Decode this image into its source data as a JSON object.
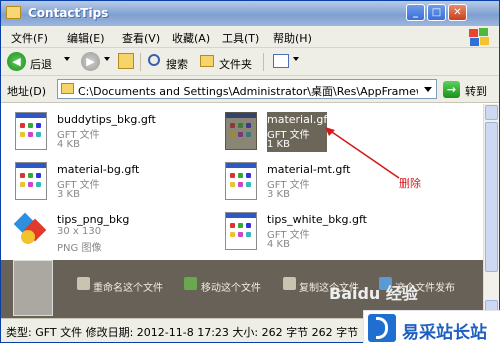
{
  "window": {
    "title": "ContactTips"
  },
  "menubar": {
    "items": [
      "文件(F)",
      "编辑(E)",
      "查看(V)",
      "收藏(A)",
      "工具(T)",
      "帮助(H)"
    ]
  },
  "toolbar": {
    "back_label": "后退",
    "search_label": "搜索",
    "folders_label": "文件夹"
  },
  "address": {
    "label": "地址(D)",
    "value": "C:\\Documents and Settings\\Administrator\\桌面\\Res\\AppFramework\\Conta",
    "go_label": "转到"
  },
  "files": [
    {
      "name": "buddytips_bkg.gft",
      "type": "GFT 文件",
      "size": "4 KB",
      "selected": false
    },
    {
      "name": "material.gft",
      "type": "GFT 文件",
      "size": "1 KB",
      "selected": true
    },
    {
      "name": "material-bg.gft",
      "type": "GFT 文件",
      "size": "3 KB",
      "selected": false
    },
    {
      "name": "material-mt.gft",
      "type": "GFT 文件",
      "size": "3 KB",
      "selected": false
    },
    {
      "name": "tips_png_bkg",
      "type": "30 x 130",
      "size": "PNG 图像",
      "selected": false
    },
    {
      "name": "tips_white_bkg.gft",
      "type": "GFT 文件",
      "size": "4 KB",
      "selected": false
    }
  ],
  "annotation": {
    "text": "删除"
  },
  "overlay": {
    "actions": [
      "重命名这个文件",
      "移动这个文件",
      "复制这个文件",
      "这个文件发布"
    ],
    "baidu_text": "Baidu 经验"
  },
  "status": {
    "text": "类型: GFT 文件 修改日期: 2012-11-8 17:23 大小: 262 字节 262 字节"
  },
  "watermark": {
    "text": "易采站长站"
  },
  "colors": {
    "title_bar": "#8aa8d6",
    "chrome": "#efeee6",
    "selection": "#6b6658",
    "annotation": "#d21a1a"
  }
}
